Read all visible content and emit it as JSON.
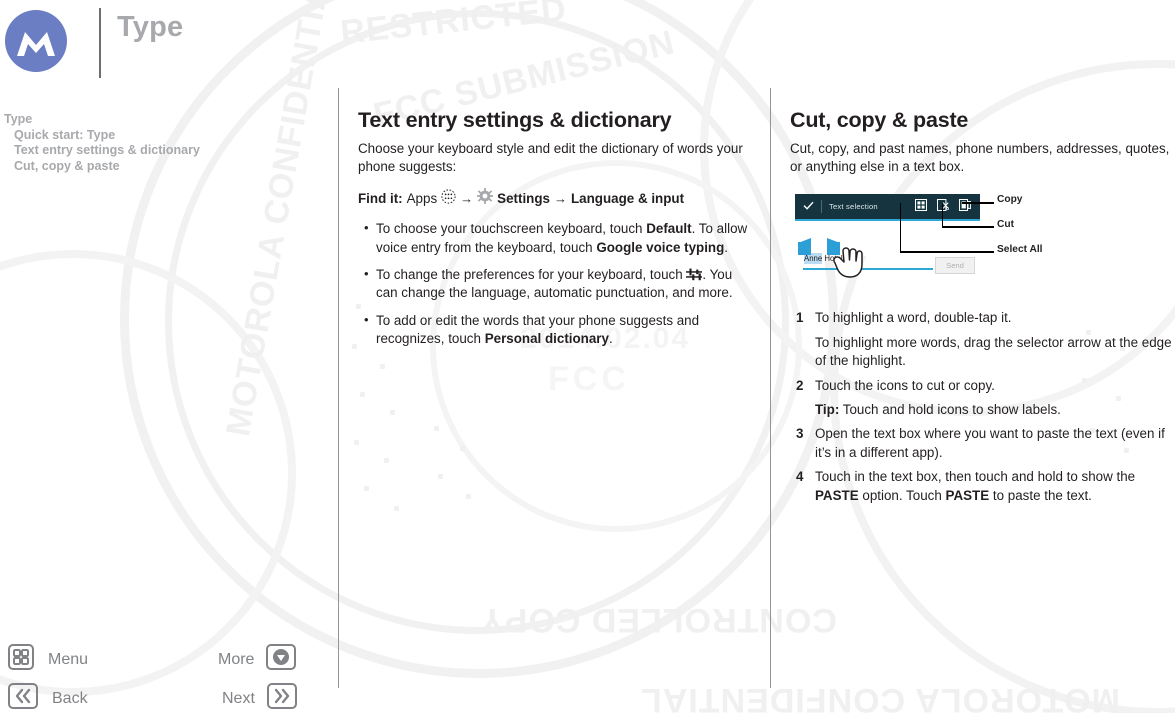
{
  "header": {
    "title": "Type",
    "logo_icon": "motorola-m-logo-icon",
    "logo_color": "#6b7dc3",
    "title_color": "#a7a9ac"
  },
  "toc": {
    "root": "Type",
    "items": [
      "Quick start: Type",
      "Text entry settings & dictionary",
      "Cut, copy & paste"
    ]
  },
  "middle_column": {
    "heading": "Text entry settings & dictionary",
    "intro": "Choose your keyboard style and edit the dictionary of words your phone suggests:",
    "find_it": {
      "label": "Find it:",
      "apps": "Apps",
      "apps_icon": "apps-grid-icon",
      "arrow1": "→",
      "settings_icon": "gear-icon",
      "settings": "Settings",
      "arrow2": "→",
      "language_input": "Language & input"
    },
    "bullets": [
      {
        "p1": "To choose your touchscreen keyboard, touch ",
        "b1": "Default",
        "p2": ". To allow voice entry from the keyboard, touch ",
        "b2": "Google voice typing",
        "p3": "."
      },
      {
        "p1": "To change the preferences for your keyboard, touch ",
        "icon": "sliders-icon",
        "p2": ". You can change the language, automatic punctuation, and more."
      },
      {
        "p1": "To add or edit the words that your phone suggests and recognizes, touch ",
        "b1": "Personal dictionary",
        "p2": "."
      }
    ]
  },
  "right_column": {
    "heading": "Cut, copy & paste",
    "intro": "Cut, copy, and past names, phone numbers, addresses, quotes, or anything else in a text box.",
    "illustration": {
      "check_icon": "checkmark-icon",
      "toolbar_label": "Text selection",
      "toolbar_bg": "#15343f",
      "accent_color": "#2fa8d5",
      "icons": [
        {
          "name": "select-all-icon",
          "label": "Select All"
        },
        {
          "name": "cut-icon",
          "label": "Cut"
        },
        {
          "name": "copy-icon",
          "label": "Copy"
        }
      ],
      "text_selected": "Anne",
      "text_rest": " Hotel",
      "send_label": "Send",
      "hand_icon": "pointing-hand-icon",
      "callouts": [
        "Copy",
        "Cut",
        "Select All"
      ]
    },
    "steps": [
      {
        "type": "numbered",
        "text": "To highlight a word, double-tap it."
      },
      {
        "type": "sub",
        "text": "To highlight more words, drag the selector arrow at the edge of the highlight."
      },
      {
        "type": "numbered",
        "text": "Touch the icons to cut or copy."
      },
      {
        "type": "sub",
        "bold_lead": "Tip:",
        "text": " Touch and hold icons to show labels."
      },
      {
        "type": "numbered",
        "text": "Open the text box where you want to paste the text (even if it’s in a different app)."
      },
      {
        "type": "numbered_rich",
        "p1": "Touch in the text box, then touch and hold to show the ",
        "b1": "PASTE",
        "p2": " option. Touch ",
        "b2": "PASTE",
        "p3": " to paste the text."
      }
    ]
  },
  "nav": {
    "menu": {
      "label": "Menu",
      "icon": "grid-menu-icon"
    },
    "more": {
      "label": "More",
      "icon": "chevron-down-circle-icon"
    },
    "back": {
      "label": "Back",
      "icon": "double-left-chevron-icon"
    },
    "next": {
      "label": "Next",
      "icon": "double-right-chevron-icon"
    }
  },
  "watermarks": {
    "date": "2014.02.04",
    "agency": "FCC",
    "phrases": [
      "MOTOROLA CONFIDENTIAL",
      "RESTRICTED",
      "CONTROLLED COPY",
      "FCC SUBMISSION"
    ]
  }
}
